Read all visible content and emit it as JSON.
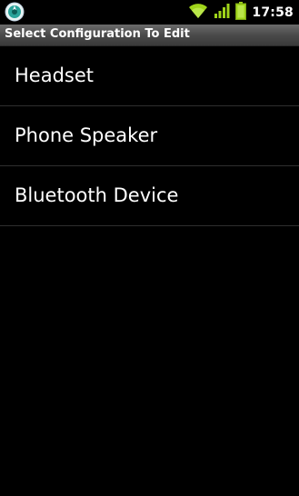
{
  "status_bar": {
    "left_icon": "app-notification-icon",
    "icons": [
      "wifi-icon",
      "signal-icon",
      "battery-icon"
    ],
    "time": "17:58",
    "accent": "#9fd41a"
  },
  "title_bar": {
    "title": "Select Configuration To Edit"
  },
  "list": {
    "items": [
      {
        "label": "Headset"
      },
      {
        "label": "Phone Speaker"
      },
      {
        "label": "Bluetooth Device"
      }
    ]
  }
}
